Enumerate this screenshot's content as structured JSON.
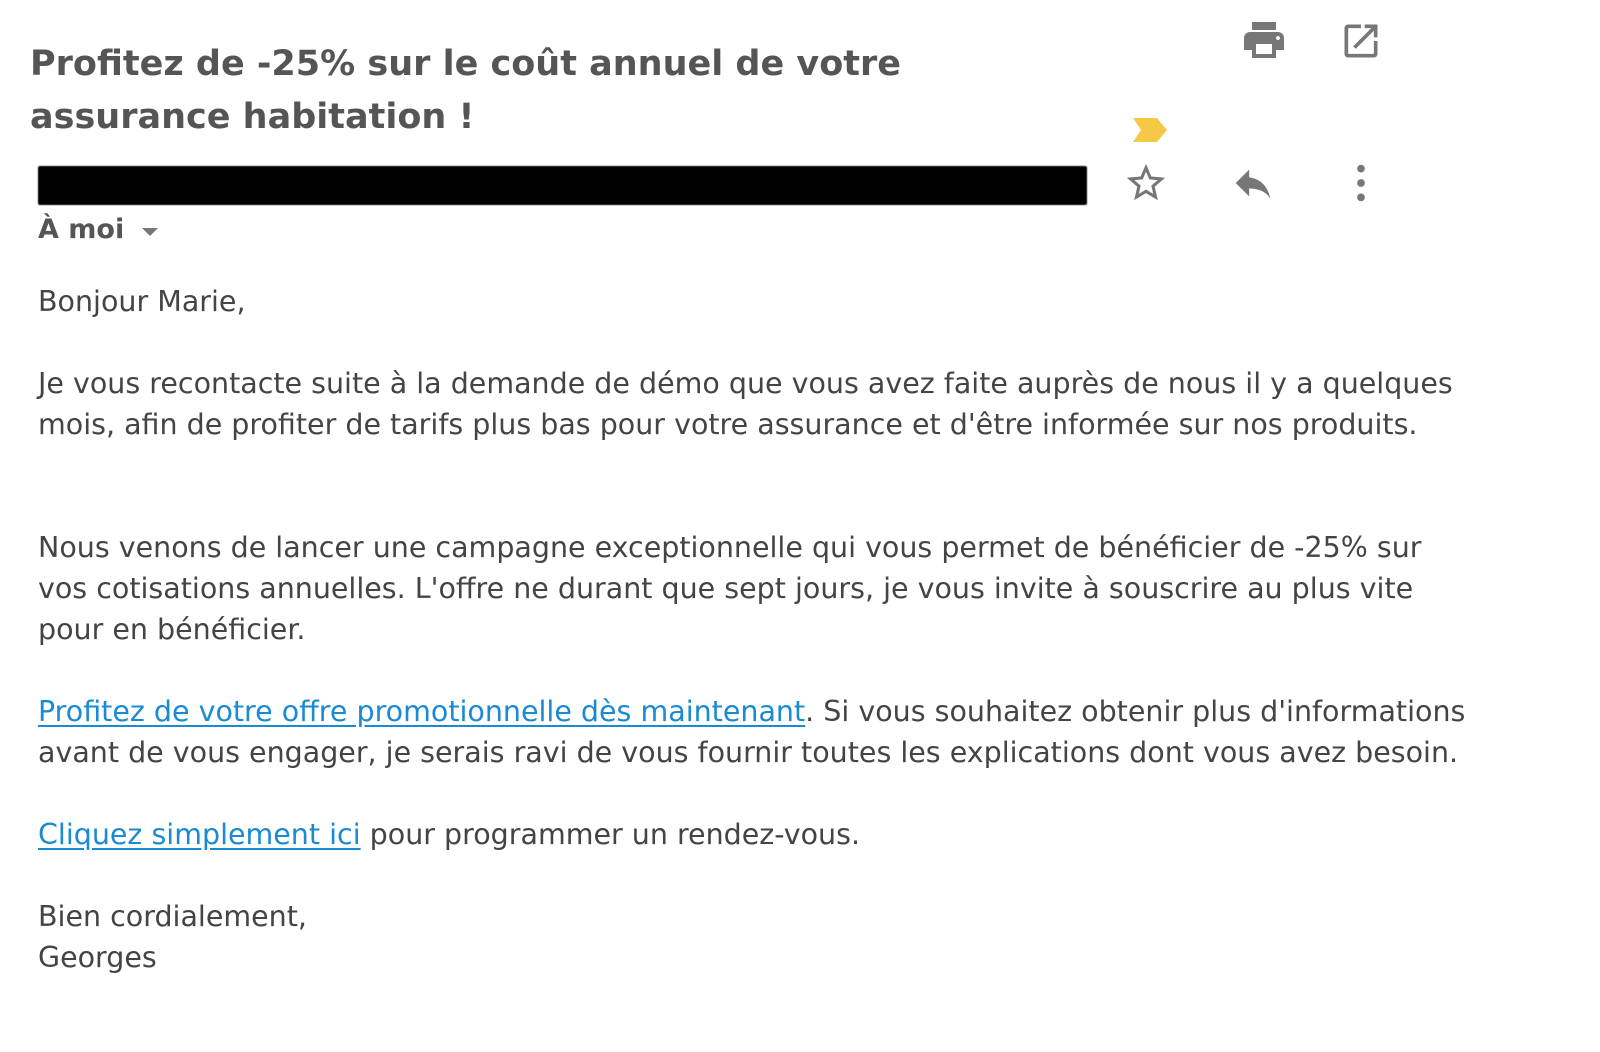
{
  "email": {
    "subject_line1": "Profitez de -25% sur le coût annuel de votre",
    "subject_line2": "assurance habitation !",
    "recipient": "À moi",
    "greeting": "Bonjour Marie,",
    "para1_line1": "Je vous recontacte suite à la demande de démo que vous avez faite auprès de nous il y a quelques",
    "para1_line2": "mois, afin de profiter de tarifs plus bas pour votre assurance et d'être informée sur nos produits.",
    "para2_line1": "Nous venons de lancer une campagne exceptionnelle qui vous permet de bénéficier de -25% sur",
    "para2_line2": "vos cotisations annuelles. L'offre ne durant que sept jours, je vous invite à souscrire au plus vite",
    "para2_line3": "pour en bénéficier.",
    "offer_link": "Profitez de votre offre promotionnelle dès maintenant",
    "para3_line1_rest": ". Si vous souhaitez obtenir plus d'informations",
    "para3_line2": "avant de vous engager, je serais ravi de vous fournir toutes les explications dont vous avez besoin.",
    "appointment_link": "Cliquez simplement ici",
    "para4_rest": " pour programmer un rendez-vous.",
    "closing": "Bien cordialement,",
    "signature": "Georges"
  },
  "icons": {
    "print": "print-icon",
    "open_new_window": "open-in-new-window-icon",
    "important": "importance-marker-icon",
    "star": "star-icon",
    "reply": "reply-icon",
    "more": "more-vertical-icon"
  },
  "colors": {
    "link": "#1a8ad4",
    "importance_marker": "#f7c846",
    "text": "#444444",
    "icon": "#777777"
  }
}
